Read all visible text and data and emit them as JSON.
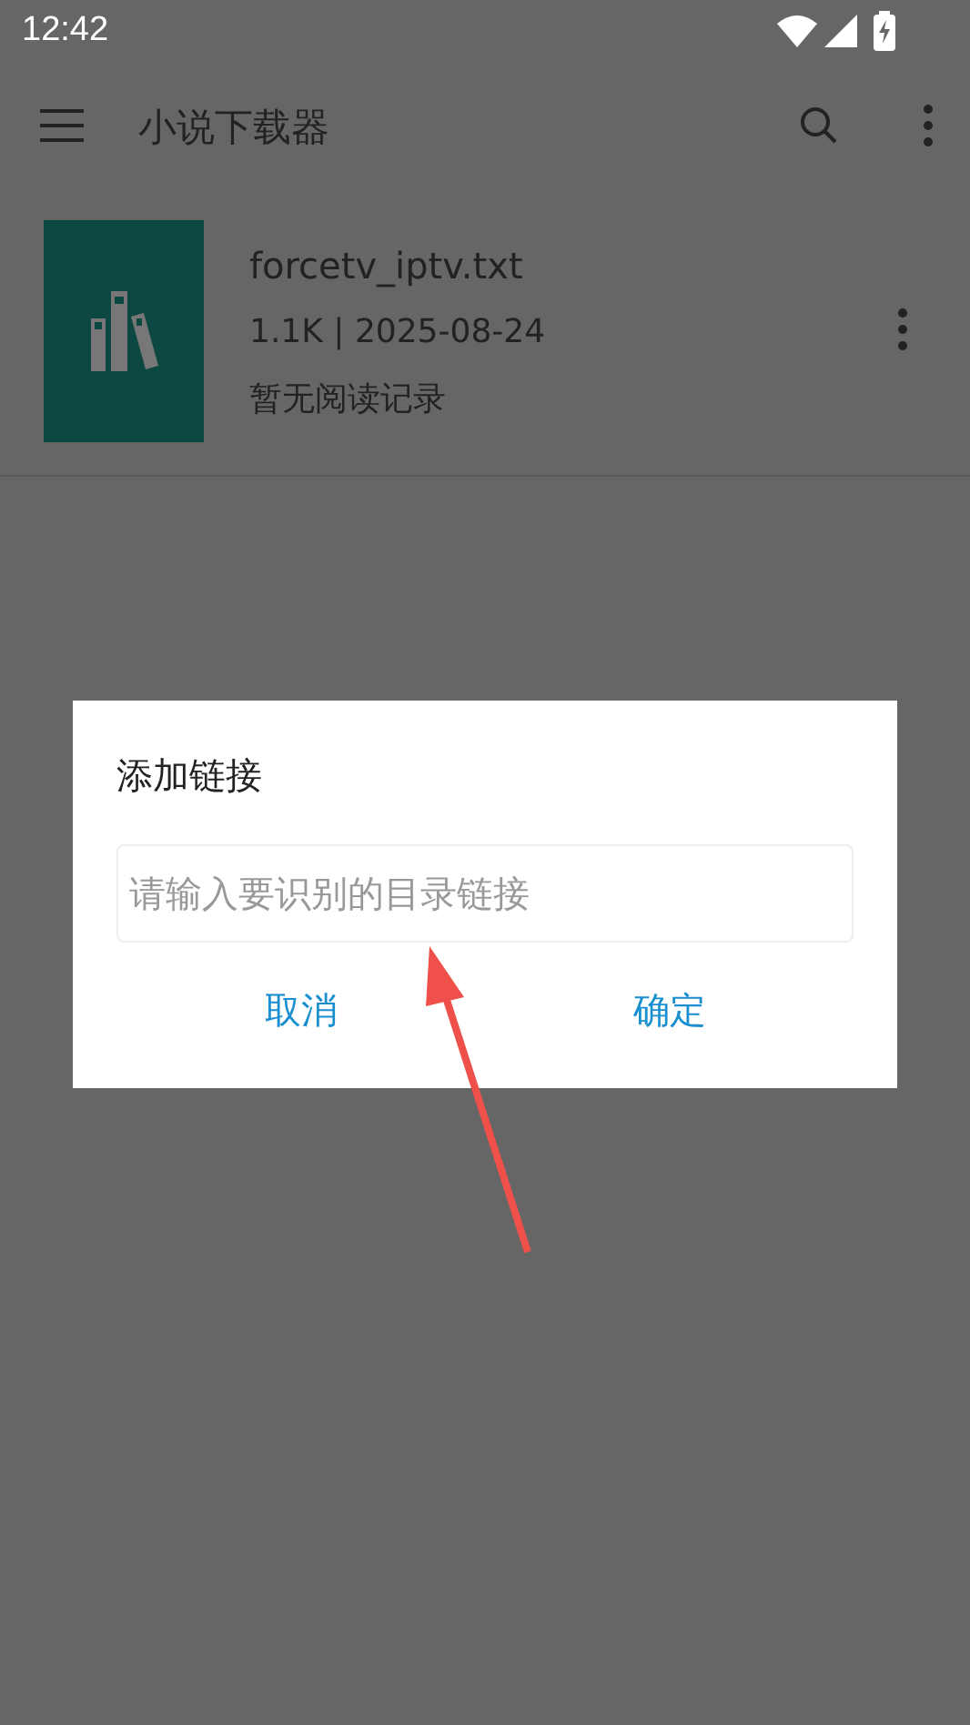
{
  "status_bar": {
    "time": "12:42"
  },
  "app_bar": {
    "title": "小说下载器"
  },
  "books": [
    {
      "name": "forcetv_iptv.txt",
      "meta": "1.1K | 2025-08-24",
      "progress": "暂无阅读记录"
    }
  ],
  "dialog": {
    "title": "添加链接",
    "field": {
      "placeholder": "请输入要识别的目录链接"
    },
    "buttons": [
      "取消",
      "确定"
    ]
  }
}
